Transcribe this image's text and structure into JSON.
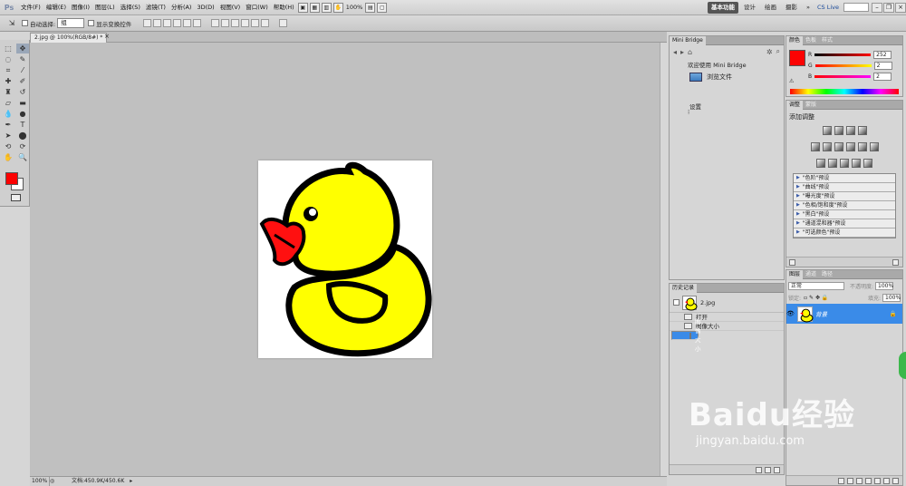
{
  "menubar": {
    "logo": "Ps",
    "items": [
      "文件(F)",
      "编辑(E)",
      "图像(I)",
      "图层(L)",
      "选择(S)",
      "滤镜(T)",
      "分析(A)",
      "3D(D)",
      "视图(V)",
      "窗口(W)",
      "帮助(H)"
    ],
    "zoom": "100%",
    "workspaces": [
      "基本功能",
      "设计",
      "绘画",
      "摄影"
    ],
    "more": "»",
    "cslive": "CS Live"
  },
  "options": {
    "auto_select_label": "自动选择:",
    "auto_select_value": "组",
    "show_transform_label": "显示变换控件"
  },
  "document": {
    "tab_title": "2.jpg @ 100%(RGB/8#) *",
    "status_zoom": "100%",
    "status_doc": "文档:450.9K/450.6K"
  },
  "minibridge": {
    "title": "Mini Bridge",
    "welcome": "欢迎使用 Mini Bridge",
    "browse": "浏览文件",
    "settings": "设置"
  },
  "history": {
    "title": "历史记录",
    "snapshot": "2.jpg",
    "items": [
      "打开",
      "图像大小",
      "图像大小"
    ]
  },
  "color": {
    "tabs": [
      "颜色",
      "色板",
      "样式"
    ],
    "channels": [
      {
        "label": "R",
        "value": "252"
      },
      {
        "label": "G",
        "value": "2"
      },
      {
        "label": "B",
        "value": "2"
      }
    ],
    "foreground": "#fc0202"
  },
  "adjustments": {
    "tabs": [
      "调整",
      "蒙版"
    ],
    "title": "添加调整",
    "presets": [
      "\"色阶\"预设",
      "\"曲线\"预设",
      "\"曝光度\"预设",
      "\"色相/饱和度\"预设",
      "\"黑白\"预设",
      "\"通道混和器\"预设",
      "\"可选颜色\"预设"
    ]
  },
  "layers": {
    "tabs": [
      "图层",
      "通道",
      "路径"
    ],
    "blend_mode": "正常",
    "opacity_label": "不透明度:",
    "opacity": "100%",
    "lock_label": "锁定:",
    "fill_label": "填充:",
    "fill": "100%",
    "layer_name": "背景"
  },
  "watermark": {
    "brand": "Baidu经验",
    "url": "jingyan.baidu.com"
  }
}
